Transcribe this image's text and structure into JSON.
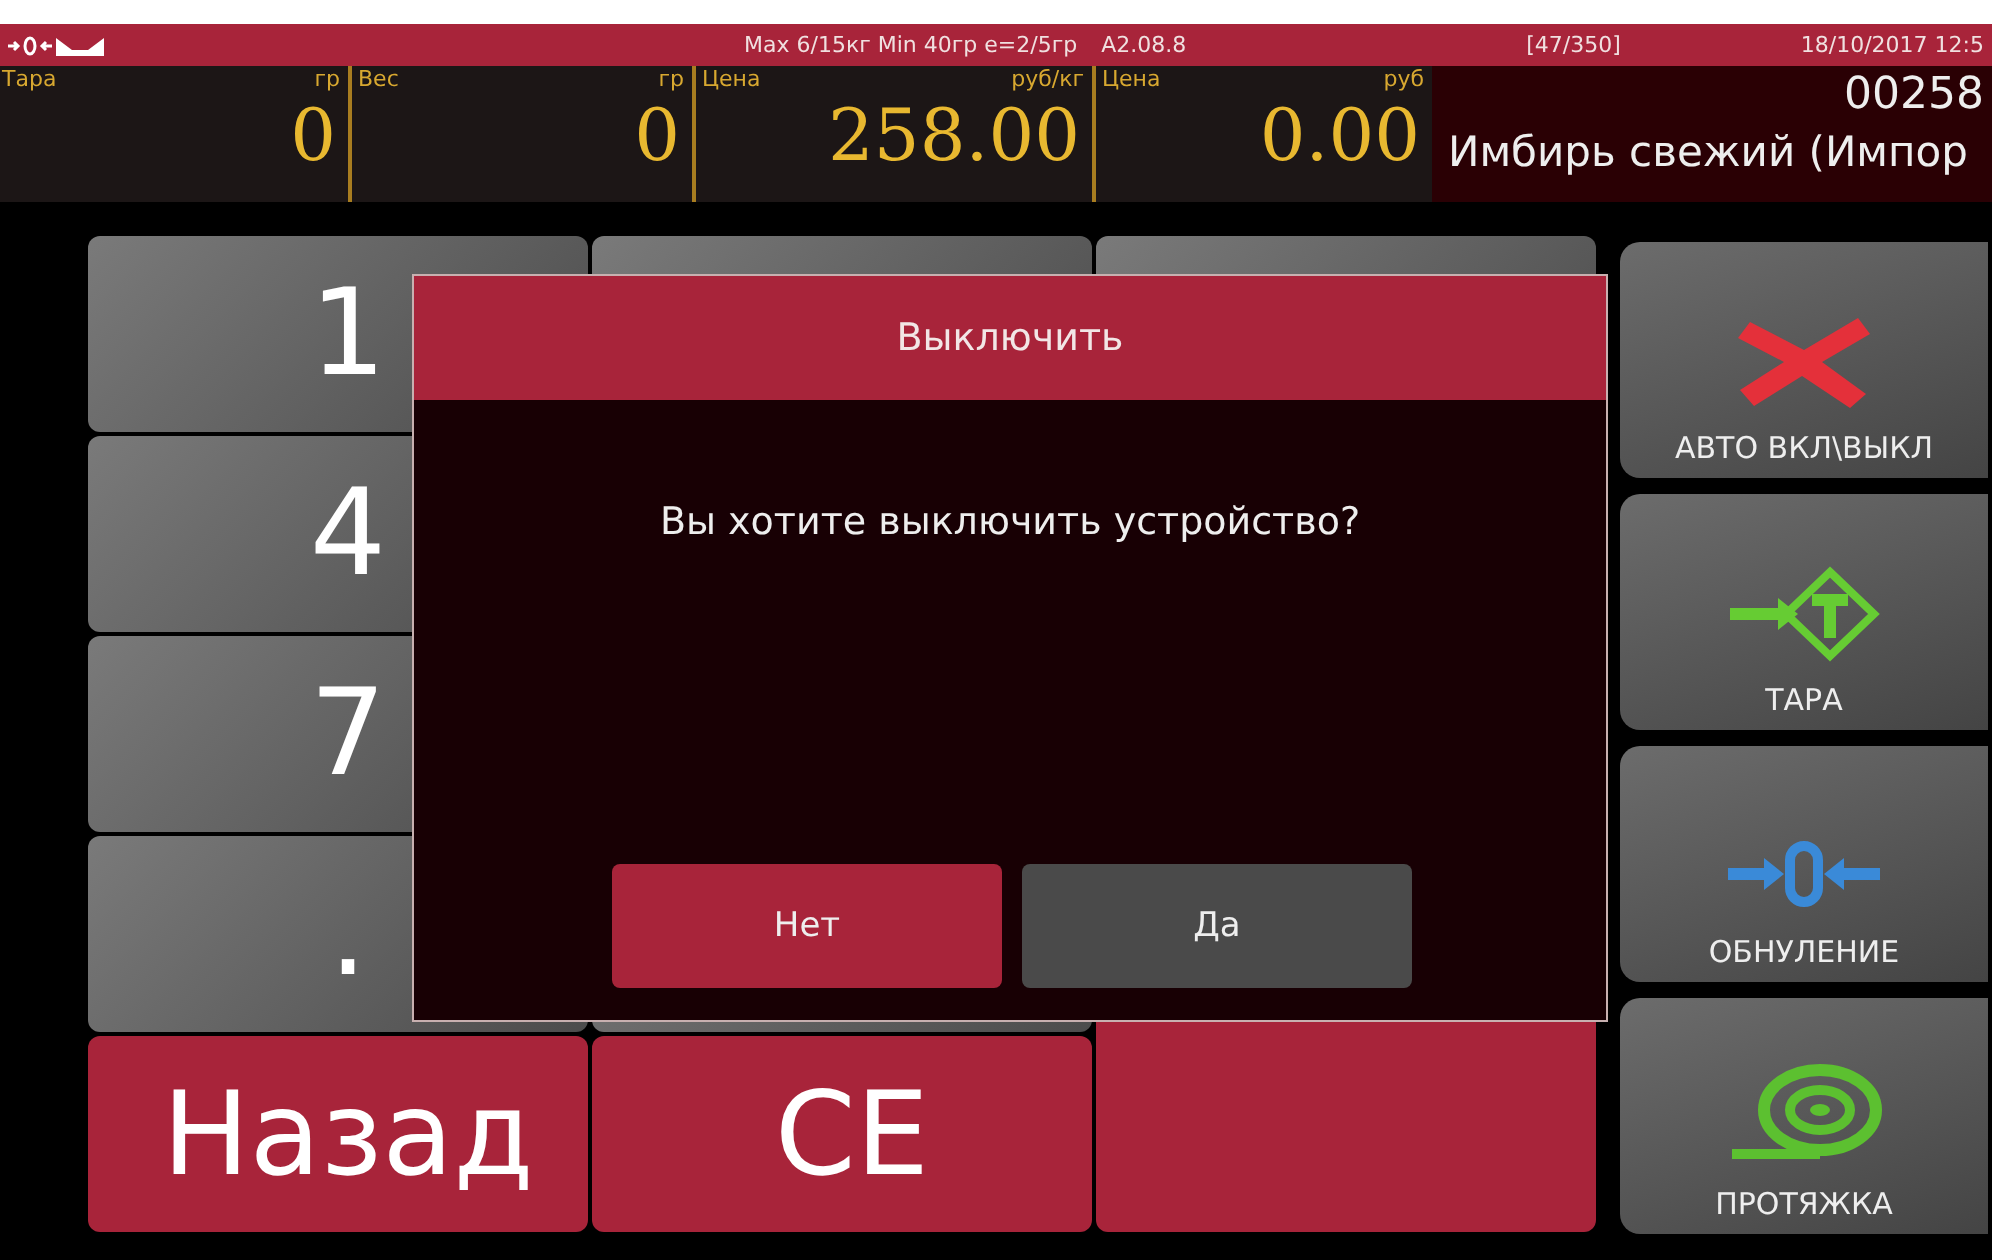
{
  "status_bar": {
    "scale_info": "Max 6/15кг Min 40гр e=2/5гр",
    "version": "A2.08.8",
    "counter": "[47/350]",
    "datetime": "18/10/2017 12:5"
  },
  "readouts": [
    {
      "label": "Тара",
      "unit": "гр",
      "value": "0"
    },
    {
      "label": "Вес",
      "unit": "гр",
      "value": "0"
    },
    {
      "label": "Цена",
      "unit": "руб/кг",
      "value": "258.00"
    },
    {
      "label": "Цена",
      "unit": "руб",
      "value": "0.00"
    }
  ],
  "product": {
    "code": "00258",
    "name": "Имбирь свежий (Импор"
  },
  "keypad": [
    [
      {
        "kind": "digit",
        "label": "1"
      },
      {
        "kind": "digit"
      },
      {
        "kind": "digit"
      }
    ],
    [
      {
        "kind": "digit",
        "label": "4"
      },
      {
        "kind": "covered"
      },
      {
        "kind": "covered"
      }
    ],
    [
      {
        "kind": "digit",
        "label": "7"
      },
      {
        "kind": "covered"
      },
      {
        "kind": "covered"
      }
    ],
    [
      {
        "kind": "digit",
        "label": "."
      },
      {
        "kind": "digit"
      },
      {
        "kind": "tall"
      }
    ],
    [
      {
        "kind": "action",
        "label": "Назад"
      },
      {
        "kind": "action",
        "label": "CE"
      }
    ]
  ],
  "side_buttons": [
    {
      "label": "АВТО ВКЛ\\ВЫКЛ"
    },
    {
      "label": "ТАРА"
    },
    {
      "label": "ОБНУЛЕНИЕ"
    },
    {
      "label": "ПРОТЯЖКА"
    }
  ],
  "dialog": {
    "title": "Выключить",
    "message": "Вы хотите выключить устройство?",
    "buttons": [
      {
        "label": "Нет",
        "kind": "primary"
      },
      {
        "label": "Да",
        "kind": "secondary"
      }
    ]
  }
}
